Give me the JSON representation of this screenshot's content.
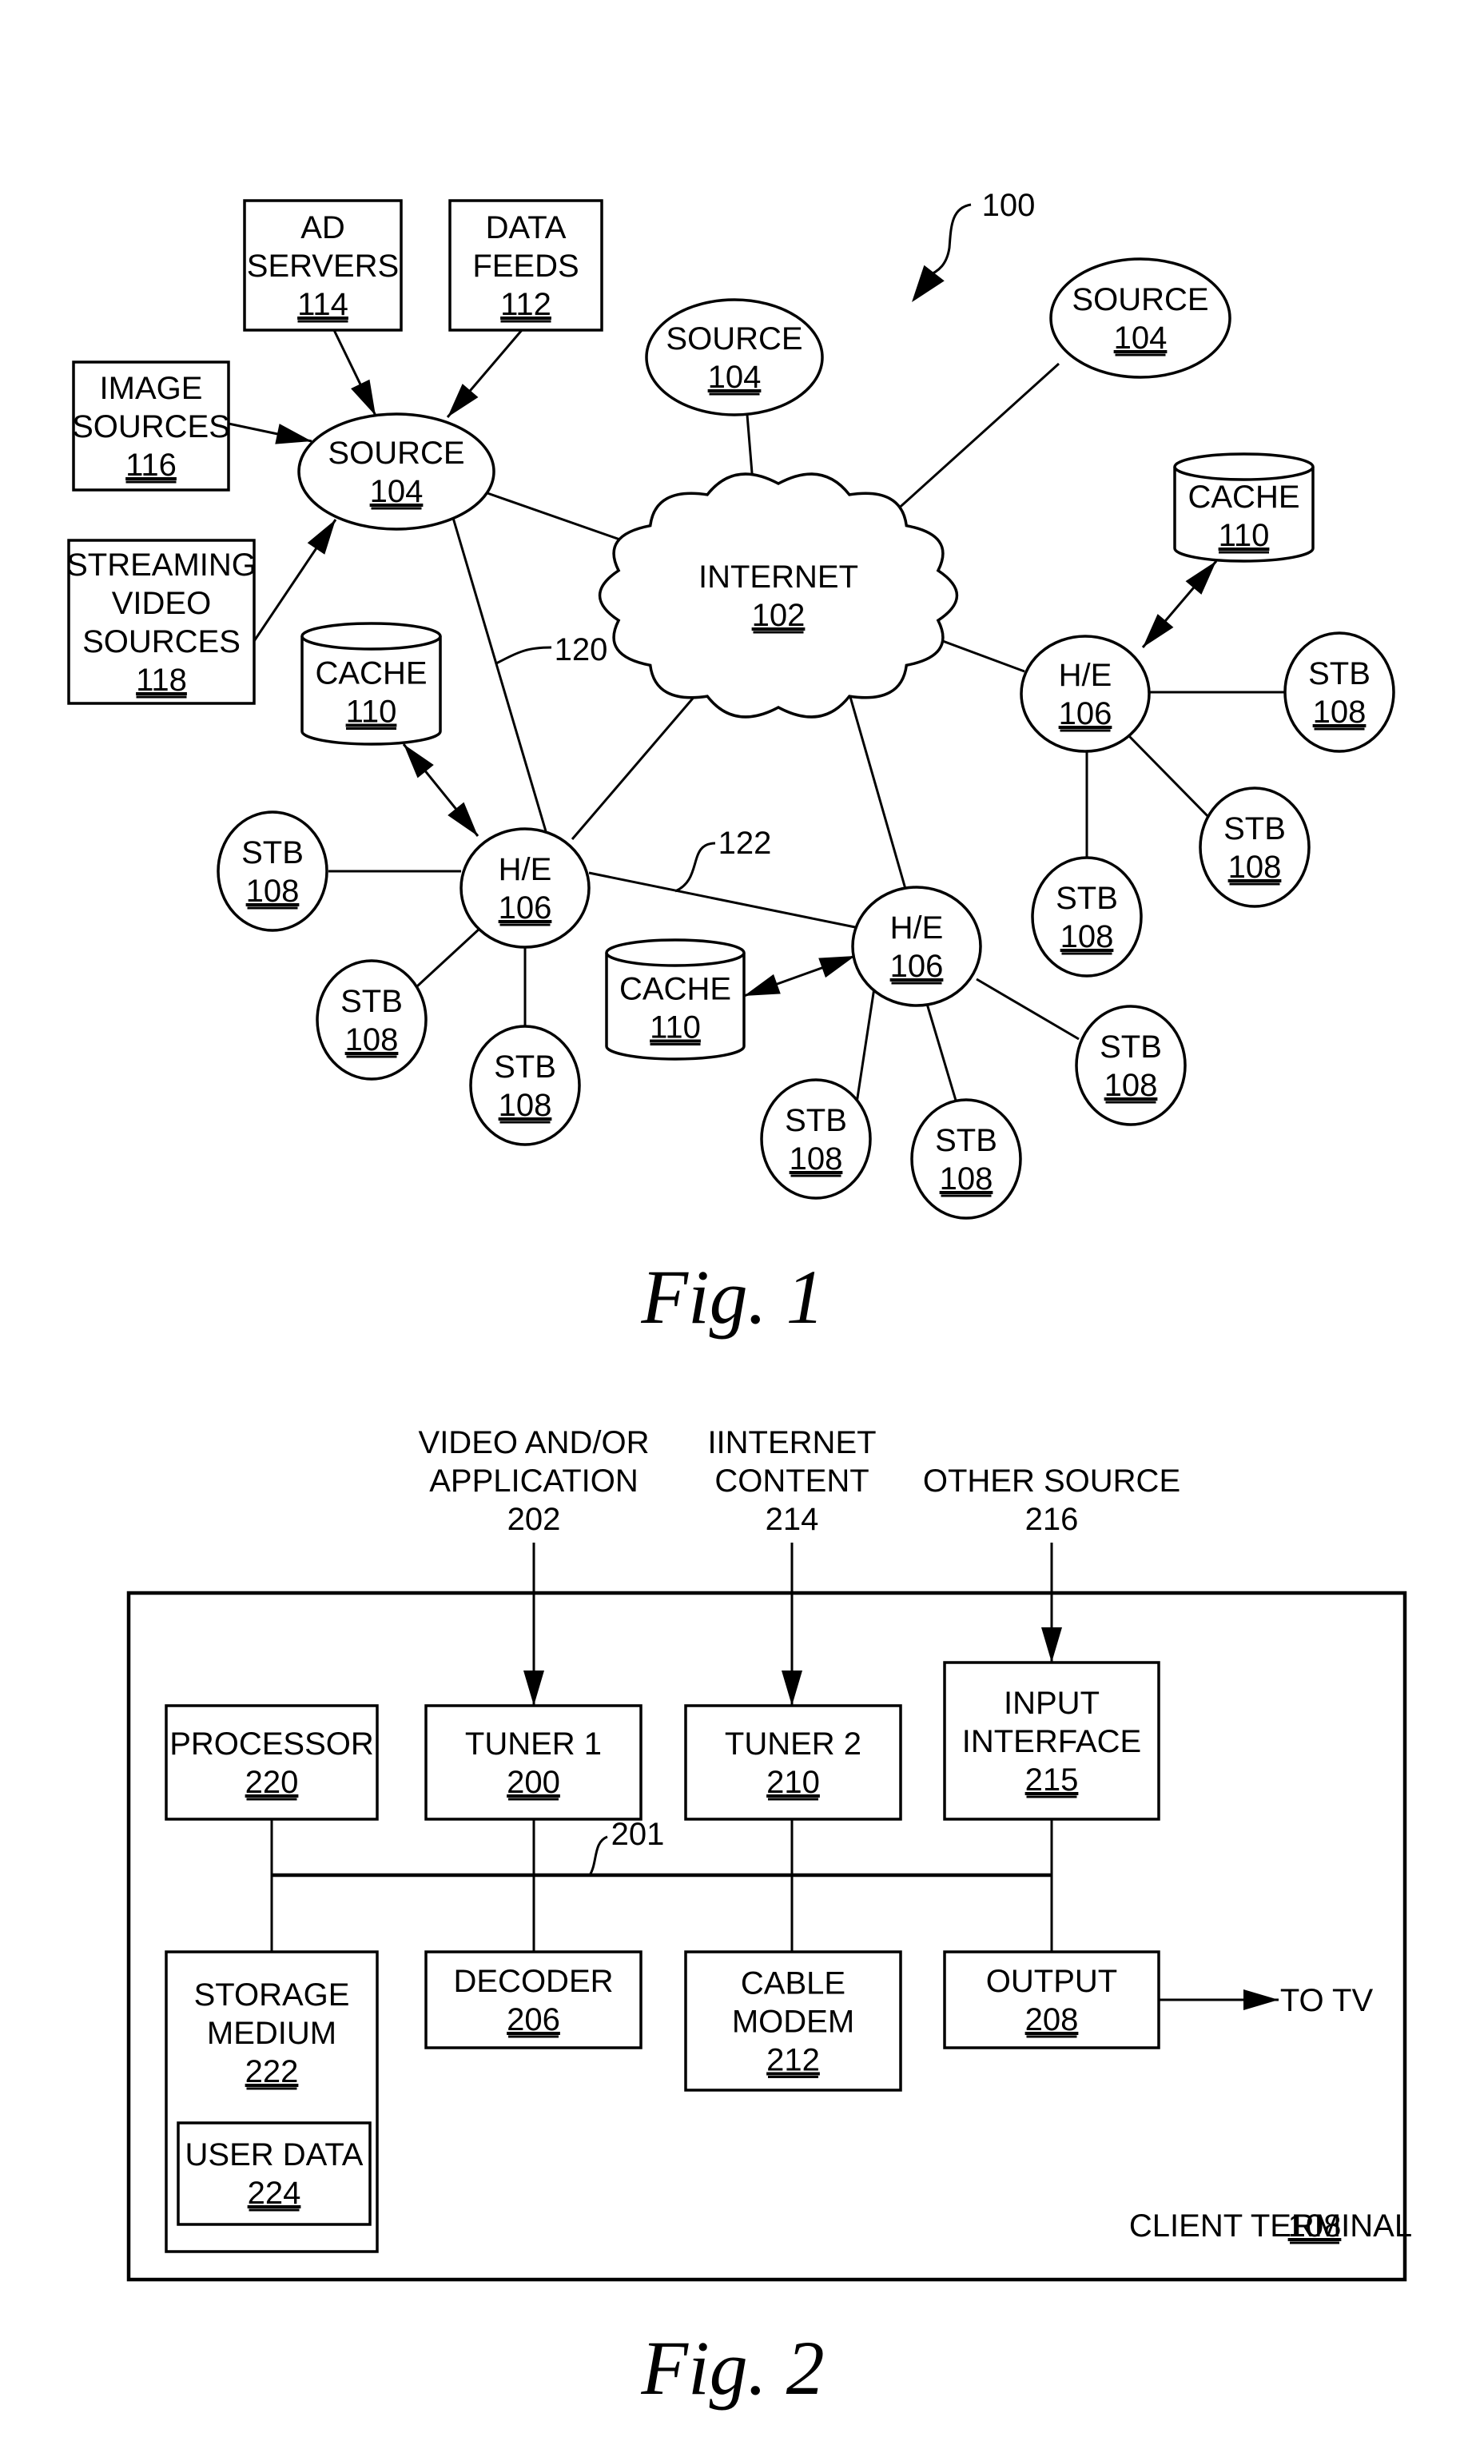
{
  "fig1": {
    "caption": "Fig. 1",
    "system_ref": "100",
    "internet": {
      "label": "INTERNET",
      "ref": "102"
    },
    "link_refs": {
      "upper": "120",
      "lower": "122"
    },
    "source_boxes": [
      {
        "id": "ad-servers",
        "lines": [
          "AD",
          "SERVERS"
        ],
        "ref": "114"
      },
      {
        "id": "data-feeds",
        "lines": [
          "DATA",
          "FEEDS"
        ],
        "ref": "112"
      },
      {
        "id": "image-sources",
        "lines": [
          "IMAGE",
          "SOURCES"
        ],
        "ref": "116"
      },
      {
        "id": "streaming-video-sources",
        "lines": [
          "STREAMING",
          "VIDEO",
          "SOURCES"
        ],
        "ref": "118"
      }
    ],
    "sources": [
      {
        "label": "SOURCE",
        "ref": "104"
      },
      {
        "label": "SOURCE",
        "ref": "104"
      },
      {
        "label": "SOURCE",
        "ref": "104"
      }
    ],
    "caches": [
      {
        "label": "CACHE",
        "ref": "110"
      },
      {
        "label": "CACHE",
        "ref": "110"
      },
      {
        "label": "CACHE",
        "ref": "110"
      }
    ],
    "headends": [
      {
        "label": "H/E",
        "ref": "106"
      },
      {
        "label": "H/E",
        "ref": "106"
      },
      {
        "label": "H/E",
        "ref": "106"
      }
    ],
    "stb": {
      "label": "STB",
      "ref": "108"
    }
  },
  "fig2": {
    "caption": "Fig. 2",
    "inputs": [
      {
        "lines": [
          "VIDEO AND/OR",
          "APPLICATION"
        ],
        "ref": "202"
      },
      {
        "lines": [
          "IINTERNET",
          "CONTENT"
        ],
        "ref": "214"
      },
      {
        "lines": [
          "OTHER SOURCE"
        ],
        "ref": "216"
      }
    ],
    "blocks": {
      "processor": {
        "lines": [
          "PROCESSOR"
        ],
        "ref": "220"
      },
      "tuner1": {
        "lines": [
          "TUNER 1"
        ],
        "ref": "200"
      },
      "tuner2": {
        "lines": [
          "TUNER 2"
        ],
        "ref": "210"
      },
      "input_interface": {
        "lines": [
          "INPUT",
          "INTERFACE"
        ],
        "ref": "215"
      },
      "storage": {
        "lines": [
          "STORAGE",
          "MEDIUM"
        ],
        "ref": "222"
      },
      "user_data": {
        "lines": [
          "USER DATA"
        ],
        "ref": "224"
      },
      "decoder": {
        "lines": [
          "DECODER"
        ],
        "ref": "206"
      },
      "cable_modem": {
        "lines": [
          "CABLE",
          "MODEM"
        ],
        "ref": "212"
      },
      "output": {
        "lines": [
          "OUTPUT"
        ],
        "ref": "208"
      }
    },
    "bus_ref": "201",
    "to_tv": "TO TV",
    "terminal": {
      "label": "CLIENT TERMINAL",
      "ref": "108"
    }
  }
}
